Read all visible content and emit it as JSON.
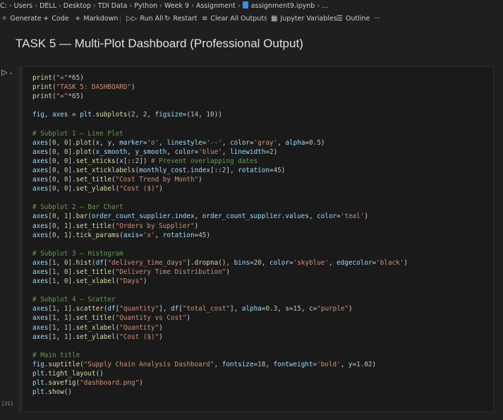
{
  "breadcrumb": [
    "C:",
    "Users",
    "DELL",
    "Desktop",
    "TDI Data",
    "Python",
    "Week 9",
    "Assignment",
    "assignment9.ipynb",
    "..."
  ],
  "toolbar": {
    "generate": "Generate",
    "code": "Code",
    "markdown": "Markdown",
    "run_all": "Run All",
    "restart": "Restart",
    "clear_outputs": "Clear All Outputs",
    "variables": "Jupyter Variables",
    "outline": "Outline",
    "more": "···"
  },
  "markdown_heading": "TASK 5 — Multi-Plot Dashboard (Professional Output)",
  "execution_count": "[21]",
  "code_lines": [
    [
      [
        "fn",
        "print"
      ],
      [
        "txt",
        "("
      ],
      [
        "str",
        "\"=\""
      ],
      [
        "txt",
        "*"
      ],
      [
        "num",
        "65"
      ],
      [
        "txt",
        ")"
      ]
    ],
    [
      [
        "fn",
        "print"
      ],
      [
        "txt",
        "("
      ],
      [
        "str",
        "\"TASK 5: DASHBOARD\""
      ],
      [
        "txt",
        ")"
      ]
    ],
    [
      [
        "fn",
        "print"
      ],
      [
        "txt",
        "("
      ],
      [
        "str",
        "\"=\""
      ],
      [
        "txt",
        "*"
      ],
      [
        "num",
        "65"
      ],
      [
        "txt",
        ")"
      ]
    ],
    [],
    [
      [
        "var",
        "fig"
      ],
      [
        "txt",
        ", "
      ],
      [
        "var",
        "axes"
      ],
      [
        "txt",
        " = "
      ],
      [
        "var",
        "plt"
      ],
      [
        "txt",
        "."
      ],
      [
        "fn",
        "subplots"
      ],
      [
        "txt",
        "("
      ],
      [
        "num",
        "2"
      ],
      [
        "txt",
        ", "
      ],
      [
        "num",
        "2"
      ],
      [
        "txt",
        ", "
      ],
      [
        "var",
        "figsize"
      ],
      [
        "txt",
        "=("
      ],
      [
        "num",
        "14"
      ],
      [
        "txt",
        ", "
      ],
      [
        "num",
        "10"
      ],
      [
        "txt",
        "))"
      ]
    ],
    [],
    [
      [
        "com",
        "# Subplot 1 – Line Plot"
      ]
    ],
    [
      [
        "var",
        "axes"
      ],
      [
        "txt",
        "["
      ],
      [
        "num",
        "0"
      ],
      [
        "txt",
        ", "
      ],
      [
        "num",
        "0"
      ],
      [
        "txt",
        "]."
      ],
      [
        "fn",
        "plot"
      ],
      [
        "txt",
        "("
      ],
      [
        "var",
        "x"
      ],
      [
        "txt",
        ", "
      ],
      [
        "var",
        "y"
      ],
      [
        "txt",
        ", "
      ],
      [
        "var",
        "marker"
      ],
      [
        "txt",
        "="
      ],
      [
        "str",
        "'o'"
      ],
      [
        "txt",
        ", "
      ],
      [
        "var",
        "linestyle"
      ],
      [
        "txt",
        "="
      ],
      [
        "str",
        "'--'"
      ],
      [
        "txt",
        ", "
      ],
      [
        "var",
        "color"
      ],
      [
        "txt",
        "="
      ],
      [
        "str",
        "'gray'"
      ],
      [
        "txt",
        ", "
      ],
      [
        "var",
        "alpha"
      ],
      [
        "txt",
        "="
      ],
      [
        "num",
        "0.5"
      ],
      [
        "txt",
        ")"
      ]
    ],
    [
      [
        "var",
        "axes"
      ],
      [
        "txt",
        "["
      ],
      [
        "num",
        "0"
      ],
      [
        "txt",
        ", "
      ],
      [
        "num",
        "0"
      ],
      [
        "txt",
        "]."
      ],
      [
        "fn",
        "plot"
      ],
      [
        "txt",
        "("
      ],
      [
        "var",
        "x_smooth"
      ],
      [
        "txt",
        ", "
      ],
      [
        "var",
        "y_smooth"
      ],
      [
        "txt",
        ", "
      ],
      [
        "var",
        "color"
      ],
      [
        "txt",
        "="
      ],
      [
        "str",
        "'blue'"
      ],
      [
        "txt",
        ", "
      ],
      [
        "var",
        "linewidth"
      ],
      [
        "txt",
        "="
      ],
      [
        "num",
        "2"
      ],
      [
        "txt",
        ")"
      ]
    ],
    [
      [
        "var",
        "axes"
      ],
      [
        "txt",
        "["
      ],
      [
        "num",
        "0"
      ],
      [
        "txt",
        ", "
      ],
      [
        "num",
        "0"
      ],
      [
        "txt",
        "]."
      ],
      [
        "fn",
        "set_xticks"
      ],
      [
        "txt",
        "("
      ],
      [
        "var",
        "x"
      ],
      [
        "txt",
        "[::"
      ],
      [
        "num",
        "2"
      ],
      [
        "txt",
        "]) "
      ],
      [
        "com",
        "# Prevent overlapping dates"
      ]
    ],
    [
      [
        "var",
        "axes"
      ],
      [
        "txt",
        "["
      ],
      [
        "num",
        "0"
      ],
      [
        "txt",
        ", "
      ],
      [
        "num",
        "0"
      ],
      [
        "txt",
        "]."
      ],
      [
        "fn",
        "set_xticklabels"
      ],
      [
        "txt",
        "("
      ],
      [
        "var",
        "monthly_cost"
      ],
      [
        "txt",
        "."
      ],
      [
        "var",
        "index"
      ],
      [
        "txt",
        "[::"
      ],
      [
        "num",
        "2"
      ],
      [
        "txt",
        "], "
      ],
      [
        "var",
        "rotation"
      ],
      [
        "txt",
        "="
      ],
      [
        "num",
        "45"
      ],
      [
        "txt",
        ")"
      ]
    ],
    [
      [
        "var",
        "axes"
      ],
      [
        "txt",
        "["
      ],
      [
        "num",
        "0"
      ],
      [
        "txt",
        ", "
      ],
      [
        "num",
        "0"
      ],
      [
        "txt",
        "]."
      ],
      [
        "fn",
        "set_title"
      ],
      [
        "txt",
        "("
      ],
      [
        "str",
        "\"Cost Trend by Month\""
      ],
      [
        "txt",
        ")"
      ]
    ],
    [
      [
        "var",
        "axes"
      ],
      [
        "txt",
        "["
      ],
      [
        "num",
        "0"
      ],
      [
        "txt",
        ", "
      ],
      [
        "num",
        "0"
      ],
      [
        "txt",
        "]."
      ],
      [
        "fn",
        "set_ylabel"
      ],
      [
        "txt",
        "("
      ],
      [
        "str",
        "\"Cost ($)\""
      ],
      [
        "txt",
        ")"
      ]
    ],
    [],
    [
      [
        "com",
        "# Subplot 2 – Bar Chart"
      ]
    ],
    [
      [
        "var",
        "axes"
      ],
      [
        "txt",
        "["
      ],
      [
        "num",
        "0"
      ],
      [
        "txt",
        ", "
      ],
      [
        "num",
        "1"
      ],
      [
        "txt",
        "]."
      ],
      [
        "fn",
        "bar"
      ],
      [
        "txt",
        "("
      ],
      [
        "var",
        "order_count_supplier"
      ],
      [
        "txt",
        "."
      ],
      [
        "var",
        "index"
      ],
      [
        "txt",
        ", "
      ],
      [
        "var",
        "order_count_supplier"
      ],
      [
        "txt",
        "."
      ],
      [
        "var",
        "values"
      ],
      [
        "txt",
        ", "
      ],
      [
        "var",
        "color"
      ],
      [
        "txt",
        "="
      ],
      [
        "str",
        "'teal'"
      ],
      [
        "txt",
        ")"
      ]
    ],
    [
      [
        "var",
        "axes"
      ],
      [
        "txt",
        "["
      ],
      [
        "num",
        "0"
      ],
      [
        "txt",
        ", "
      ],
      [
        "num",
        "1"
      ],
      [
        "txt",
        "]."
      ],
      [
        "fn",
        "set_title"
      ],
      [
        "txt",
        "("
      ],
      [
        "str",
        "\"Orders by Supplier\""
      ],
      [
        "txt",
        ")"
      ]
    ],
    [
      [
        "var",
        "axes"
      ],
      [
        "txt",
        "["
      ],
      [
        "num",
        "0"
      ],
      [
        "txt",
        ", "
      ],
      [
        "num",
        "1"
      ],
      [
        "txt",
        "]."
      ],
      [
        "fn",
        "tick_params"
      ],
      [
        "txt",
        "("
      ],
      [
        "var",
        "axis"
      ],
      [
        "txt",
        "="
      ],
      [
        "str",
        "'x'"
      ],
      [
        "txt",
        ", "
      ],
      [
        "var",
        "rotation"
      ],
      [
        "txt",
        "="
      ],
      [
        "num",
        "45"
      ],
      [
        "txt",
        ")"
      ]
    ],
    [],
    [
      [
        "com",
        "# Subplot 3 – Histogram"
      ]
    ],
    [
      [
        "var",
        "axes"
      ],
      [
        "txt",
        "["
      ],
      [
        "num",
        "1"
      ],
      [
        "txt",
        ", "
      ],
      [
        "num",
        "0"
      ],
      [
        "txt",
        "]."
      ],
      [
        "fn",
        "hist"
      ],
      [
        "txt",
        "("
      ],
      [
        "var",
        "df"
      ],
      [
        "txt",
        "["
      ],
      [
        "str",
        "\"delivery_time_days\""
      ],
      [
        "txt",
        "]."
      ],
      [
        "fn",
        "dropna"
      ],
      [
        "txt",
        "(), "
      ],
      [
        "var",
        "bins"
      ],
      [
        "txt",
        "="
      ],
      [
        "num",
        "20"
      ],
      [
        "txt",
        ", "
      ],
      [
        "var",
        "color"
      ],
      [
        "txt",
        "="
      ],
      [
        "str",
        "'skyblue'"
      ],
      [
        "txt",
        ", "
      ],
      [
        "var",
        "edgecolor"
      ],
      [
        "txt",
        "="
      ],
      [
        "str",
        "'black'"
      ],
      [
        "txt",
        ")"
      ]
    ],
    [
      [
        "var",
        "axes"
      ],
      [
        "txt",
        "["
      ],
      [
        "num",
        "1"
      ],
      [
        "txt",
        ", "
      ],
      [
        "num",
        "0"
      ],
      [
        "txt",
        "]."
      ],
      [
        "fn",
        "set_title"
      ],
      [
        "txt",
        "("
      ],
      [
        "str",
        "\"Delivery Time Distribution\""
      ],
      [
        "txt",
        ")"
      ]
    ],
    [
      [
        "var",
        "axes"
      ],
      [
        "txt",
        "["
      ],
      [
        "num",
        "1"
      ],
      [
        "txt",
        ", "
      ],
      [
        "num",
        "0"
      ],
      [
        "txt",
        "]."
      ],
      [
        "fn",
        "set_xlabel"
      ],
      [
        "txt",
        "("
      ],
      [
        "str",
        "\"Days\""
      ],
      [
        "txt",
        ")"
      ]
    ],
    [],
    [
      [
        "com",
        "# Subplot 4 – Scatter"
      ]
    ],
    [
      [
        "var",
        "axes"
      ],
      [
        "txt",
        "["
      ],
      [
        "num",
        "1"
      ],
      [
        "txt",
        ", "
      ],
      [
        "num",
        "1"
      ],
      [
        "txt",
        "]."
      ],
      [
        "fn",
        "scatter"
      ],
      [
        "txt",
        "("
      ],
      [
        "var",
        "df"
      ],
      [
        "txt",
        "["
      ],
      [
        "str",
        "\"quantity\""
      ],
      [
        "txt",
        "], "
      ],
      [
        "var",
        "df"
      ],
      [
        "txt",
        "["
      ],
      [
        "str",
        "\"total_cost\""
      ],
      [
        "txt",
        "], "
      ],
      [
        "var",
        "alpha"
      ],
      [
        "txt",
        "="
      ],
      [
        "num",
        "0.3"
      ],
      [
        "txt",
        ", "
      ],
      [
        "var",
        "s"
      ],
      [
        "txt",
        "="
      ],
      [
        "num",
        "15"
      ],
      [
        "txt",
        ", "
      ],
      [
        "var",
        "c"
      ],
      [
        "txt",
        "="
      ],
      [
        "str",
        "\"purple\""
      ],
      [
        "txt",
        ")"
      ]
    ],
    [
      [
        "var",
        "axes"
      ],
      [
        "txt",
        "["
      ],
      [
        "num",
        "1"
      ],
      [
        "txt",
        ", "
      ],
      [
        "num",
        "1"
      ],
      [
        "txt",
        "]."
      ],
      [
        "fn",
        "set_title"
      ],
      [
        "txt",
        "("
      ],
      [
        "str",
        "\"Quantity vs Cost\""
      ],
      [
        "txt",
        ")"
      ]
    ],
    [
      [
        "var",
        "axes"
      ],
      [
        "txt",
        "["
      ],
      [
        "num",
        "1"
      ],
      [
        "txt",
        ", "
      ],
      [
        "num",
        "1"
      ],
      [
        "txt",
        "]."
      ],
      [
        "fn",
        "set_xlabel"
      ],
      [
        "txt",
        "("
      ],
      [
        "str",
        "\"Quantity\""
      ],
      [
        "txt",
        ")"
      ]
    ],
    [
      [
        "var",
        "axes"
      ],
      [
        "txt",
        "["
      ],
      [
        "num",
        "1"
      ],
      [
        "txt",
        ", "
      ],
      [
        "num",
        "1"
      ],
      [
        "txt",
        "]."
      ],
      [
        "fn",
        "set_ylabel"
      ],
      [
        "txt",
        "("
      ],
      [
        "str",
        "\"Cost ($)\""
      ],
      [
        "txt",
        ")"
      ]
    ],
    [],
    [
      [
        "com",
        "# Main title"
      ]
    ],
    [
      [
        "var",
        "fig"
      ],
      [
        "txt",
        "."
      ],
      [
        "fn",
        "suptitle"
      ],
      [
        "txt",
        "("
      ],
      [
        "str",
        "\"Supply Chain Analysis Dashboard\""
      ],
      [
        "txt",
        ", "
      ],
      [
        "var",
        "fontsize"
      ],
      [
        "txt",
        "="
      ],
      [
        "num",
        "18"
      ],
      [
        "txt",
        ", "
      ],
      [
        "var",
        "fontweight"
      ],
      [
        "txt",
        "="
      ],
      [
        "str",
        "'bold'"
      ],
      [
        "txt",
        ", "
      ],
      [
        "var",
        "y"
      ],
      [
        "txt",
        "="
      ],
      [
        "num",
        "1.02"
      ],
      [
        "txt",
        ")"
      ]
    ],
    [
      [
        "var",
        "plt"
      ],
      [
        "txt",
        "."
      ],
      [
        "fn",
        "tight_layout"
      ],
      [
        "txt",
        "()"
      ]
    ],
    [
      [
        "var",
        "plt"
      ],
      [
        "txt",
        "."
      ],
      [
        "fn",
        "savefig"
      ],
      [
        "txt",
        "("
      ],
      [
        "str",
        "\"dashboard.png\""
      ],
      [
        "txt",
        ")"
      ]
    ],
    [
      [
        "var",
        "plt"
      ],
      [
        "txt",
        "."
      ],
      [
        "fn",
        "show"
      ],
      [
        "txt",
        "()"
      ]
    ]
  ]
}
